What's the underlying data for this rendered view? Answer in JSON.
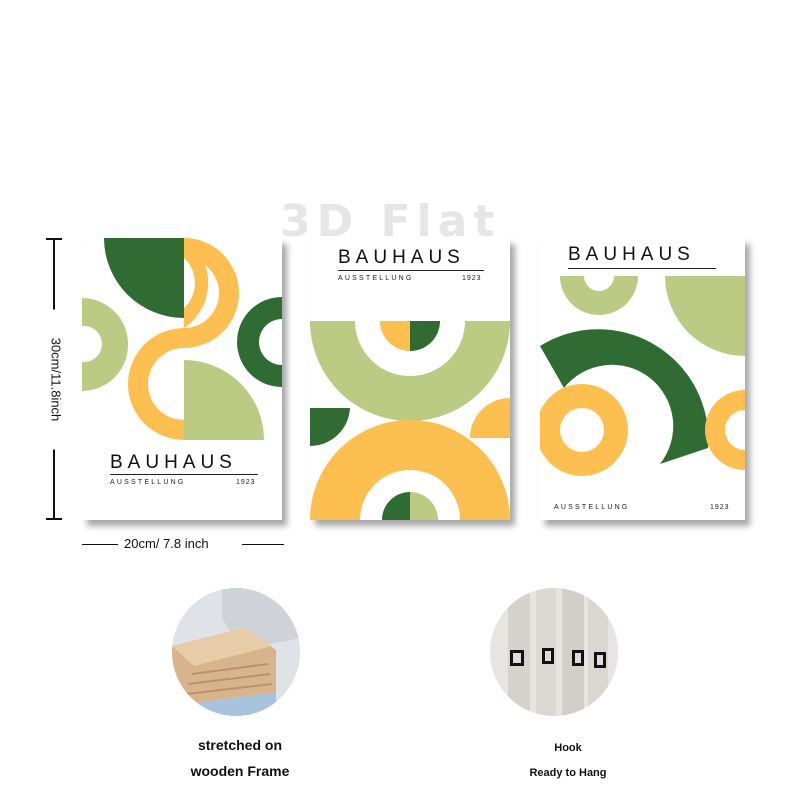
{
  "watermark": "3D Flat",
  "posters": [
    {
      "title": "BAUHAUS",
      "subtitle": "AUSSTELLUNG",
      "year": "1923"
    },
    {
      "title": "BAUHAUS",
      "subtitle": "AUSSTELLUNG",
      "year": "1923"
    },
    {
      "title": "BAUHAUS",
      "subtitle": "AUSSTELLUNG",
      "year": "1923"
    }
  ],
  "dimensions": {
    "height_label": "30cm/11.8inch",
    "width_label": "20cm/ 7.8 inch"
  },
  "features": [
    {
      "line1": "stretched on",
      "line2": "wooden Frame"
    },
    {
      "line1": "Hook",
      "line2": "Ready to Hang"
    }
  ],
  "colors": {
    "dark_green": "#2f6b33",
    "light_green": "#bccb83",
    "yellow": "#fdbf50",
    "wood": "#d8b48c"
  }
}
